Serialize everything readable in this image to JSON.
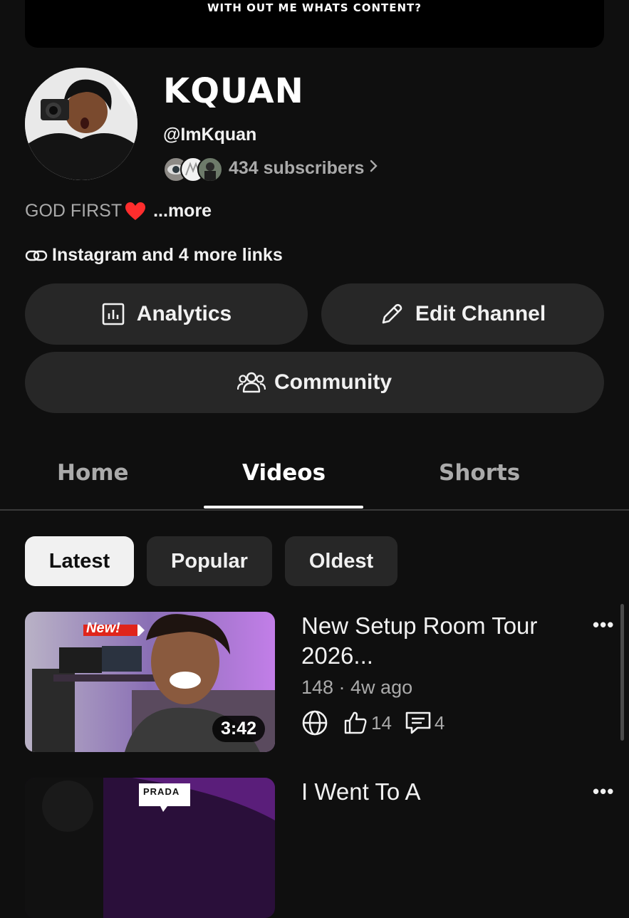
{
  "banner": {
    "text": "WITH OUT ME WHATS CONTENT?"
  },
  "channel": {
    "name": "KQUAN",
    "handle": "@ImKquan",
    "subscribers": "434 subscribers",
    "description": "GOD FIRST",
    "description_more": "...more",
    "links_text": "Instagram and 4 more links"
  },
  "buttons": {
    "analytics": "Analytics",
    "edit_channel": "Edit Channel",
    "community": "Community"
  },
  "tabs": [
    {
      "label": "Home",
      "active": false
    },
    {
      "label": "Videos",
      "active": true
    },
    {
      "label": "Shorts",
      "active": false
    }
  ],
  "chips": [
    {
      "label": "Latest",
      "active": true
    },
    {
      "label": "Popular",
      "active": false
    },
    {
      "label": "Oldest",
      "active": false
    }
  ],
  "videos": [
    {
      "title": "New Setup Room Tour 2026...",
      "meta": "148 · 4w ago",
      "duration": "3:42",
      "likes": "14",
      "comments": "4",
      "thumb_badge": "New!"
    },
    {
      "title": "I Went To A",
      "thumb_badge": "PRADA"
    }
  ],
  "icons": {
    "link": "link-icon",
    "analytics": "analytics-icon",
    "edit": "pencil-icon",
    "community": "people-icon",
    "visibility": "globe-icon",
    "likes": "thumbs-up-icon",
    "comments": "comment-icon"
  },
  "colors": {
    "background": "#0f0f0f",
    "button": "#272727",
    "secondary_text": "#aaaaaa",
    "heart": "#ff2d2d"
  }
}
